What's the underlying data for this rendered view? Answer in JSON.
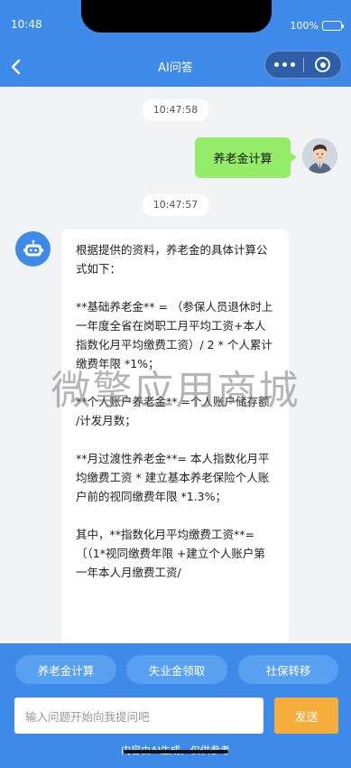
{
  "status_bar": {
    "time": "10:48",
    "battery": "100%"
  },
  "header": {
    "title": "AI问答"
  },
  "chat": {
    "timestamps": [
      "10:47:58",
      "10:47:57"
    ],
    "user_message": "养老金计算",
    "bot_message": "根据提供的资料，养老金的具体计算公式如下：\n\n**基础养老金** = （参保人员退休时上一年度全省在岗职工月平均工资+本人指数化月平均缴费工资）/ 2 * 个人累计缴费年限 *1%；\n\n**个人账户养老金** =个人账户储存额 /计发月数；\n\n**月过渡性养老金**= 本人指数化月平均缴费工资 * 建立基本养老保险个人账户前的视同缴费年限 *1.3%；\n\n其中，**指数化月平均缴费工资**= 〔（1*视同缴费年限 +建立个人账户第一年本人月缴费工资/"
  },
  "watermark": "微擎应用商城",
  "quick_actions": [
    "养老金计算",
    "失业金领取",
    "社保转移"
  ],
  "input": {
    "placeholder": "输入问题开始向我提问吧"
  },
  "send_label": "发送",
  "footer_note": "内容由AI生成，仅供参考",
  "colors": {
    "primary": "#3d8ae8",
    "user_bubble": "#95ec69",
    "send_button": "#f5ad3b"
  },
  "icons": {
    "back": "chevron-left-icon",
    "more": "more-dots-icon",
    "close": "target-circle-icon",
    "bot": "robot-icon",
    "user": "user-avatar-icon"
  }
}
